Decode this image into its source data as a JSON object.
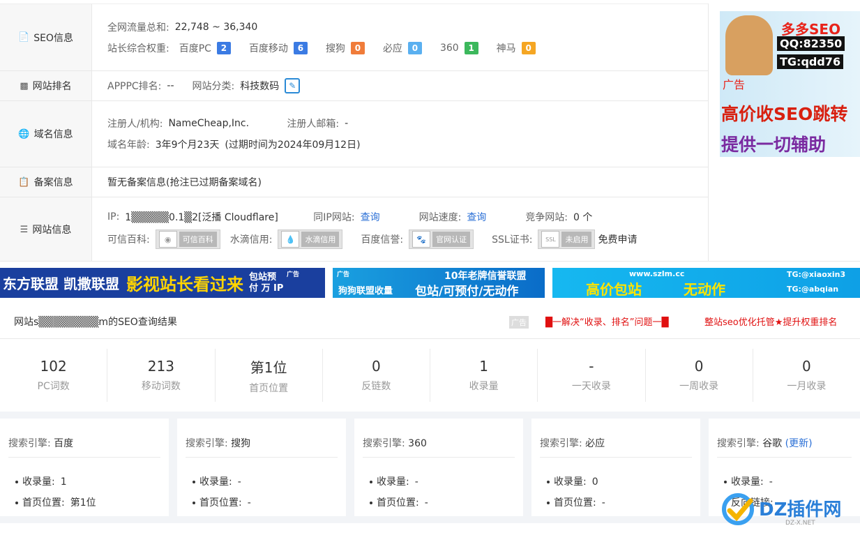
{
  "seo_info": {
    "label": "SEO信息",
    "traffic_label": "全网流量总和:",
    "traffic_value": "22,748 ~ 36,340",
    "weight_label": "站长综合权重:",
    "weights": [
      {
        "name": "百度PC",
        "value": "2",
        "color": "#3b7be3"
      },
      {
        "name": "百度移动",
        "value": "6",
        "color": "#3b7be3"
      },
      {
        "name": "搜狗",
        "value": "0",
        "color": "#f07c3a"
      },
      {
        "name": "必应",
        "value": "0",
        "color": "#5ab0f0"
      },
      {
        "name": "360",
        "value": "1",
        "color": "#3cb85c"
      },
      {
        "name": "神马",
        "value": "0",
        "color": "#f5a623"
      }
    ]
  },
  "site_rank": {
    "label": "网站排名",
    "apppc_label": "APPPC排名:",
    "apppc_value": "--",
    "category_label": "网站分类:",
    "category_value": "科技数码"
  },
  "domain_info": {
    "label": "域名信息",
    "registrar_label": "注册人/机构:",
    "registrar_value": "NameCheap,Inc.",
    "email_label": "注册人邮箱:",
    "email_value": "-",
    "age_label": "域名年龄:",
    "age_value": "3年9个月23天",
    "expire_text": "(过期时间为2024年09月12日)"
  },
  "icp_info": {
    "label": "备案信息",
    "value": "暂无备案信息(抢注已过期备案域名)"
  },
  "site_info": {
    "label": "网站信息",
    "ip_label": "IP:",
    "ip_value": "1▒▒▒▒▒0.1▒2[泛播 Cloudflare]",
    "same_ip_label": "同IP网站:",
    "same_ip_link": "查询",
    "speed_label": "网站速度:",
    "speed_link": "查询",
    "compete_label": "竞争网站:",
    "compete_value": "0 个",
    "trust_label": "可信百科:",
    "trust_badge": "可信百科",
    "water_label": "水滴信用:",
    "water_badge": "水滴信用",
    "baidu_label": "百度信誉:",
    "baidu_badge": "官网认证",
    "ssl_label": "SSL证书:",
    "ssl_badge": "未启用",
    "ssl_apply": "免费申请"
  },
  "side_ad": {
    "title": "多多SEO",
    "qq": "QQ:82350",
    "tg": "TG:qdd76",
    "tag": "广告",
    "line1": "高价收SEO跳转",
    "line2": "提供一切辅助"
  },
  "banners": [
    {
      "text": "东方联盟 凯撒联盟",
      "text2": "影视站长看过来",
      "text3": "包站预付 万 IP",
      "tag": "广告"
    },
    {
      "tag": "广告",
      "text": "狗狗联盟收量",
      "text2": "10年老牌信誉联盟",
      "text3": "包站/可预付/无动作"
    },
    {
      "text": "www.szlm.cc",
      "text2": "高价包站",
      "text3": "无动作",
      "text4": "TG:@xiaoxin3",
      "text5": "TG:@abqian"
    }
  ],
  "results": {
    "title": "网站s▒▒▒▒▒▒▒▒m的SEO查询结果",
    "ad_tag": "广告",
    "promo1": "█一解决“收录、排名”问题一█",
    "promo2": "整站seo优化托管★提升权重排名"
  },
  "stats": [
    {
      "num": "102",
      "label": "PC词数"
    },
    {
      "num": "213",
      "label": "移动词数"
    },
    {
      "num": "第1位",
      "label": "首页位置"
    },
    {
      "num": "0",
      "label": "反链数"
    },
    {
      "num": "1",
      "label": "收录量"
    },
    {
      "num": "-",
      "label": "一天收录"
    },
    {
      "num": "0",
      "label": "一周收录"
    },
    {
      "num": "0",
      "label": "一月收录"
    }
  ],
  "engines": [
    {
      "prefix": "搜索引擎:",
      "name": "百度",
      "items": [
        {
          "k": "收录量:",
          "v": "1"
        },
        {
          "k": "首页位置:",
          "v": "第1位"
        }
      ]
    },
    {
      "prefix": "搜索引擎:",
      "name": "搜狗",
      "items": [
        {
          "k": "收录量:",
          "v": "-"
        },
        {
          "k": "首页位置:",
          "v": "-"
        }
      ]
    },
    {
      "prefix": "搜索引擎:",
      "name": "360",
      "items": [
        {
          "k": "收录量:",
          "v": "-"
        },
        {
          "k": "首页位置:",
          "v": "-"
        }
      ]
    },
    {
      "prefix": "搜索引擎:",
      "name": "必应",
      "items": [
        {
          "k": "收录量:",
          "v": "0"
        },
        {
          "k": "首页位置:",
          "v": "-"
        }
      ]
    },
    {
      "prefix": "搜索引擎:",
      "name": "谷歌",
      "update": "(更新)",
      "items": [
        {
          "k": "收录量:",
          "v": "-"
        },
        {
          "k": "反向链接:",
          "v": "-"
        }
      ]
    }
  ],
  "watermark": {
    "text": "DZ插件网",
    "sub": "DZ-X.NET"
  }
}
